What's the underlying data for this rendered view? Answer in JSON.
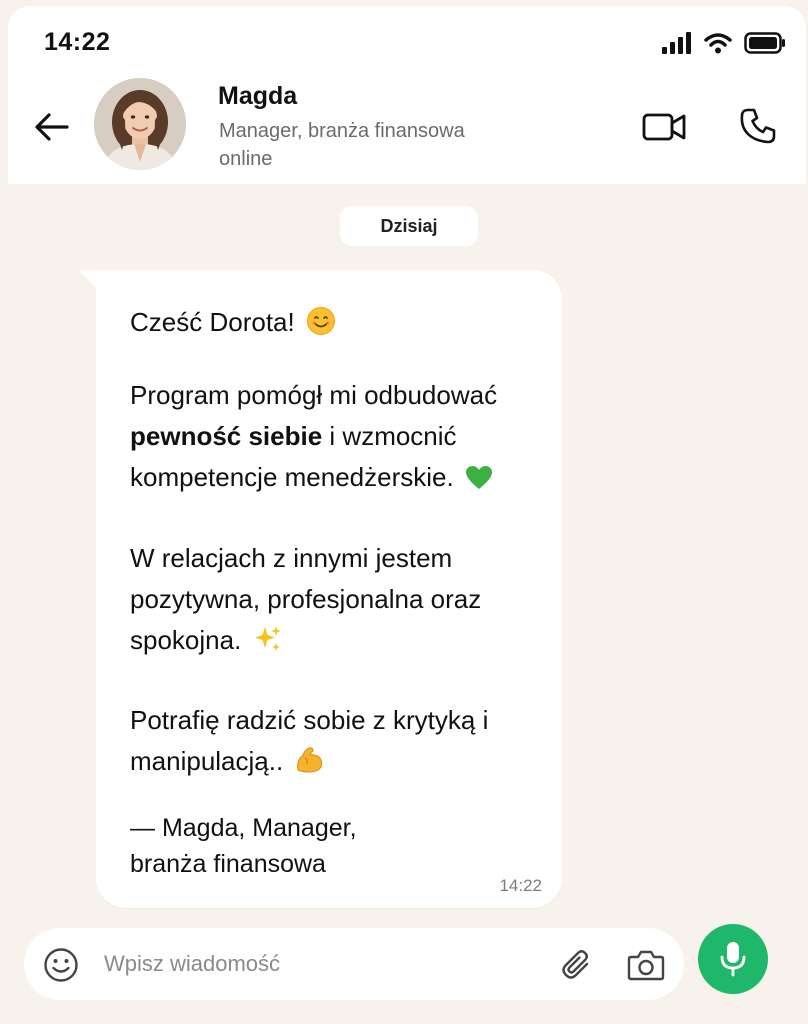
{
  "status_bar": {
    "time": "14:22"
  },
  "contact": {
    "name": "Magda",
    "subtitle": "Manager, branża finansowa",
    "status": "online"
  },
  "date_pill": "Dzisiaj",
  "message": {
    "greeting": "Cześć Dorota!",
    "p1_part1": "Program pomógł mi odbudować",
    "p1_bold": "pewność siebie",
    "p1_part2": " i wzmocnić kompetencje menedżerskie.",
    "p2": "W relacjach z innymi jestem pozytywna, profesjonalna oraz spokojna.",
    "p3": "Potrafię radzić sobie z krytyką i manipulacją..",
    "signature_line1": "— Magda, Manager,",
    "signature_line2": "branża finansowa",
    "time": "14:22",
    "icons": [
      "smile-emoji",
      "green-heart-emoji",
      "sparkles-emoji",
      "flexed-biceps-emoji"
    ]
  },
  "input": {
    "placeholder": "Wpisz wiadomość"
  },
  "colors": {
    "background": "#f7f3ec",
    "bubble": "#ffffff",
    "mic_button": "#1fb86a",
    "secondary_text": "#6b6b6b"
  },
  "icons": [
    "back-arrow-icon",
    "video-camera-icon",
    "phone-icon",
    "emoji-icon",
    "paperclip-icon",
    "camera-icon",
    "microphone-icon",
    "signal-icon",
    "wifi-icon",
    "battery-icon"
  ]
}
